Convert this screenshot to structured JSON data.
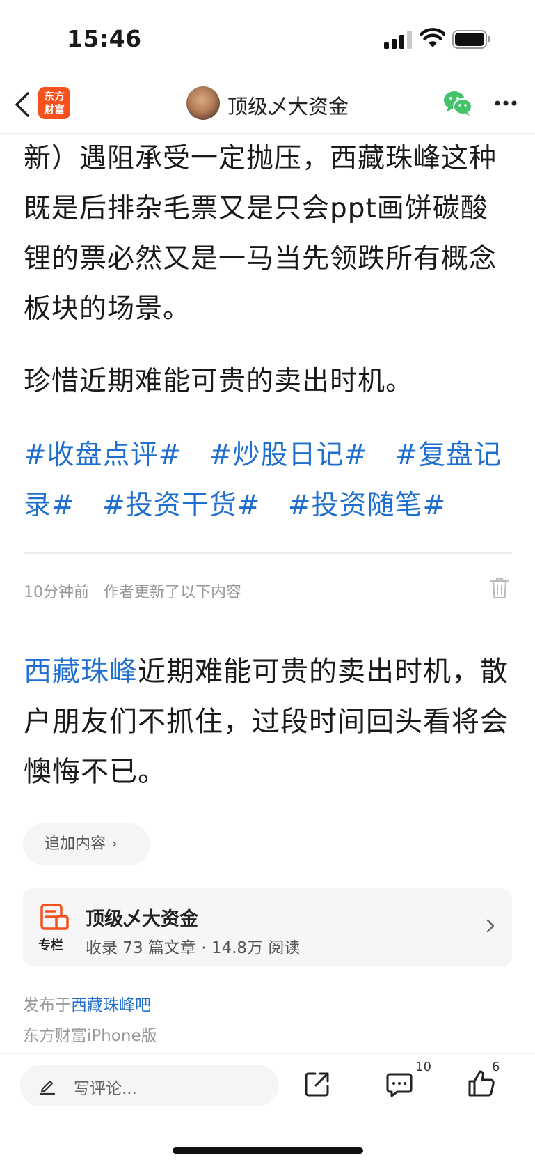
{
  "status_bar": {
    "time": "15:46"
  },
  "nav": {
    "logo_text_line1": "东方",
    "logo_text_line2": "财富",
    "title": "顶级乄大资金"
  },
  "article": {
    "paragraph_top": "新）遇阻承受一定抛压，西藏珠峰这种既是后排杂毛票又是只会ppt画饼碳酸锂的票必然又是一马当先领跌所有概念板块的场景。",
    "paragraph_cherish": "珍惜近期难能可贵的卖出时机。",
    "hashtags": [
      "#收盘点评#",
      "#炒股日记#",
      "#复盘记录#",
      "#投资干货#",
      "#投资随笔#"
    ]
  },
  "update": {
    "time_ago": "10分钟前",
    "note": "作者更新了以下内容",
    "stock_link": "西藏珠峰",
    "text": "近期难能可贵的卖出时机，散户朋友们不抓住，过段时间回头看将会懊悔不已。"
  },
  "add_content": {
    "label": "追加内容",
    "chevron": "›"
  },
  "column_card": {
    "icon_label": "专栏",
    "name": "顶级乄大资金",
    "stats": "收录 73 篇文章 · 14.8万 阅读"
  },
  "published": {
    "prefix": "发布于",
    "bar_name": "西藏珠峰吧",
    "source": "东方财富iPhone版"
  },
  "bottom_bar": {
    "comment_placeholder": "写评论...",
    "comment_count": "10",
    "like_count": "6"
  },
  "colors": {
    "link": "#1f6fd1",
    "brand": "#f4511e",
    "wechat": "#43c46b"
  },
  "icons": [
    "back-icon",
    "wechat-icon",
    "more-icon",
    "trash-icon",
    "column-icon",
    "pen-icon",
    "share-icon",
    "comment-icon",
    "like-icon"
  ]
}
